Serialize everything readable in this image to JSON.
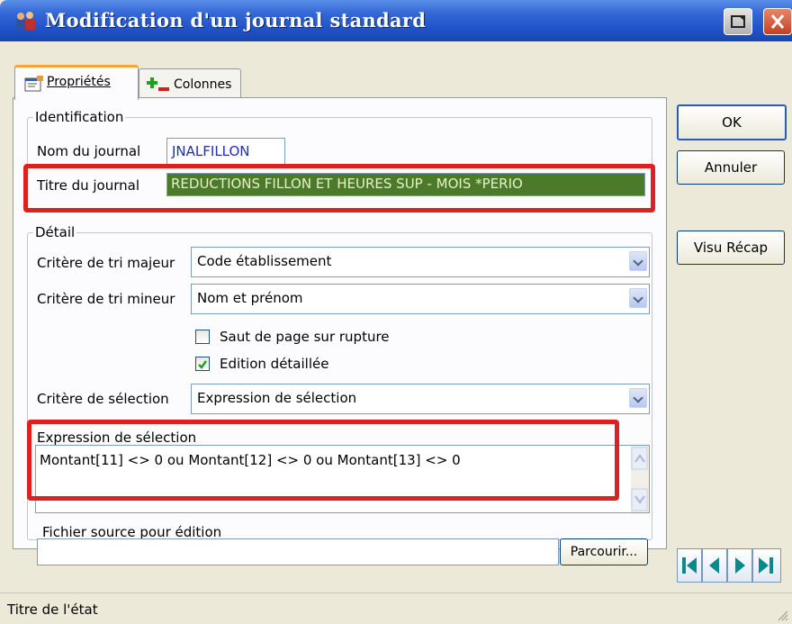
{
  "window": {
    "title": "Modification d'un journal standard",
    "icon": "people-icon"
  },
  "tabs": [
    {
      "label": "Propriétés",
      "icon": "properties-icon"
    },
    {
      "label": "Colonnes",
      "icon": "add-remove-icon"
    }
  ],
  "identification": {
    "legend": "Identification",
    "nom_label": "Nom du journal",
    "nom_value": "JNALFILLON",
    "titre_label": "Titre du journal",
    "titre_value": "REDUCTIONS FILLON ET HEURES SUP - MOIS *PERIO"
  },
  "detail": {
    "legend": "Détail",
    "tri_majeur_label": "Critère de tri majeur",
    "tri_majeur_value": "Code établissement",
    "tri_mineur_label": "Critère de tri mineur",
    "tri_mineur_value": "Nom et prénom",
    "saut_label": "Saut de page sur rupture",
    "saut_checked": false,
    "edition_label": "Edition détaillée",
    "edition_checked": true,
    "selection_label": "Critère de sélection",
    "selection_value": "Expression de sélection",
    "expression_label": "Expression de sélection",
    "expression_value": "Montant[11] <> 0 ou Montant[12] <> 0 ou Montant[13] <> 0",
    "fichier_label": "Fichier source pour édition",
    "fichier_value": "",
    "parcourir_label": "Parcourir..."
  },
  "buttons": {
    "ok": "OK",
    "annuler": "Annuler",
    "visu": "Visu Récap"
  },
  "status": {
    "text": "Titre de l'état"
  },
  "colors": {
    "highlight": "#e02020",
    "field_blue": "#1f2fb0",
    "title_bar": "#2052c8"
  }
}
